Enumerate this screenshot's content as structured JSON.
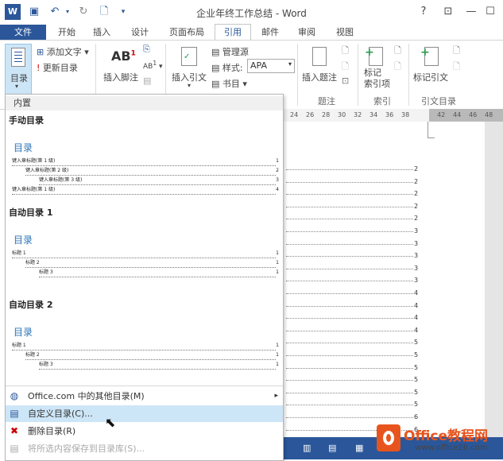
{
  "title": "企业年终工作总结 - Word",
  "window": {
    "help": "?",
    "restore": "⊡",
    "minimize": "—"
  },
  "tabs": [
    "文件",
    "开始",
    "插入",
    "设计",
    "页面布局",
    "引用",
    "邮件",
    "审阅",
    "视图"
  ],
  "ribbon": {
    "toc_button": "目录",
    "add_text": "添加文字",
    "update_toc": "更新目录",
    "insert_footnote": "插入脚注",
    "insert_citation": "插入引文",
    "manage_sources": "管理源",
    "style_label": "样式:",
    "style_value": "APA",
    "bibliography": "书目",
    "insert_caption": "插入题注",
    "mark_entry": "标记\n索引项",
    "mark_citation": "标记引文",
    "groups": {
      "captions": "题注",
      "index": "索引",
      "toa": "引文目录"
    }
  },
  "ruler": [
    "24",
    "26",
    "28",
    "30",
    "32",
    "34",
    "36",
    "38",
    "42",
    "44",
    "46",
    "48"
  ],
  "panel": {
    "builtin_header": "内置",
    "gallery": [
      {
        "name": "手动目录",
        "heading": "目录",
        "rows": [
          {
            "text": "键入章标题(第 1 级)",
            "num": "1",
            "level": 1
          },
          {
            "text": "键入章标题(第 2 级)",
            "num": "2",
            "level": 2
          },
          {
            "text": "键入章标题(第 3 级)",
            "num": "3",
            "level": 3
          },
          {
            "text": "键入章标题(第 1 级)",
            "num": "4",
            "level": 1
          }
        ]
      },
      {
        "name": "自动目录 1",
        "heading": "目录",
        "rows": [
          {
            "text": "标题 1",
            "num": "1",
            "level": 1
          },
          {
            "text": "标题 2",
            "num": "1",
            "level": 2
          },
          {
            "text": "标题 3",
            "num": "1",
            "level": 3
          }
        ]
      },
      {
        "name": "自动目录 2",
        "heading": "目录",
        "rows": [
          {
            "text": "标题 1",
            "num": "1",
            "level": 1
          },
          {
            "text": "标题 2",
            "num": "1",
            "level": 2
          },
          {
            "text": "标题 3",
            "num": "1",
            "level": 3
          }
        ]
      }
    ],
    "menu": [
      {
        "label": "Office.com 中的其他目录(M)",
        "arrow": "▸",
        "state": "normal"
      },
      {
        "label": "自定义目录(C)...",
        "state": "highlighted"
      },
      {
        "label": "删除目录(R)",
        "state": "normal"
      },
      {
        "label": "将所选内容保存到目录库(S)...",
        "state": "disabled"
      }
    ]
  },
  "document": {
    "page_numbers": [
      "2",
      "2",
      "2",
      "2",
      "2",
      "3",
      "3",
      "3",
      "3",
      "3",
      "4",
      "4",
      "4",
      "4",
      "5",
      "5",
      "5",
      "5",
      "5",
      "5",
      "6",
      "6"
    ]
  },
  "watermark": {
    "brand": "Office教程网",
    "url": "www.office26.com"
  },
  "colors": {
    "accent": "#2b579a",
    "highlight": "#cde6f7",
    "toc_heading": "#2e74b5",
    "watermark": "#e8541e"
  }
}
